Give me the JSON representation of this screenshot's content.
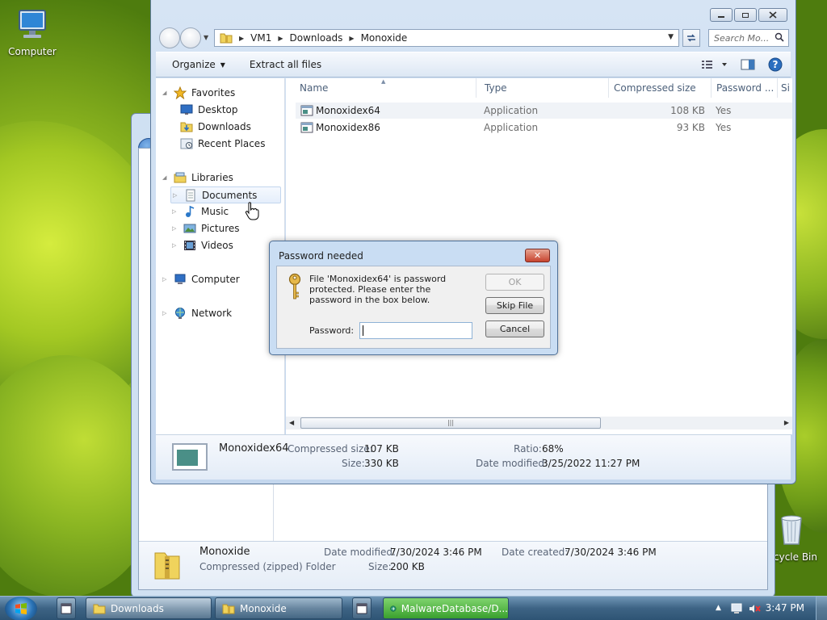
{
  "desktop": {
    "computer_label": "Computer",
    "recycle_label": "cycle Bin"
  },
  "back_window": {
    "folder_name": "Monoxide",
    "folder_type": "Compressed (zipped) Folder",
    "date_modified_label": "Date modified:",
    "date_modified": "7/30/2024 3:46 PM",
    "date_created_label": "Date created:",
    "date_created": "7/30/2024 3:46 PM",
    "size_label": "Size:",
    "size": "200 KB"
  },
  "window": {
    "breadcrumbs": [
      "VM1",
      "Downloads",
      "Monoxide"
    ],
    "search_placeholder": "Search Mo...",
    "toolbar": {
      "organize": "Organize",
      "extract_all": "Extract all files"
    },
    "nav": {
      "favorites": "Favorites",
      "desktop": "Desktop",
      "downloads": "Downloads",
      "recent_places": "Recent Places",
      "libraries": "Libraries",
      "documents": "Documents",
      "music": "Music",
      "pictures": "Pictures",
      "videos": "Videos",
      "computer": "Computer",
      "network": "Network"
    },
    "columns": {
      "name": "Name",
      "type": "Type",
      "compressed_size": "Compressed size",
      "password": "Password ...",
      "size_partial": "Si"
    },
    "files": [
      {
        "name": "Monoxidex64",
        "type": "Application",
        "compressed_size": "108 KB",
        "password": "Yes"
      },
      {
        "name": "Monoxidex86",
        "type": "Application",
        "compressed_size": "93 KB",
        "password": "Yes"
      }
    ],
    "details": {
      "name": "Monoxidex64",
      "compressed_size_label": "Compressed size:",
      "compressed_size": "107 KB",
      "size_label": "Size:",
      "size": "330 KB",
      "ratio_label": "Ratio:",
      "ratio": "68%",
      "date_modified_label": "Date modified:",
      "date_modified": "3/25/2022 11:27 PM"
    }
  },
  "dialog": {
    "title": "Password needed",
    "message": "File 'Monoxidex64' is password protected. Please enter the password in the box below.",
    "password_label": "Password:",
    "password_value": "",
    "ok": "OK",
    "skip": "Skip File",
    "cancel": "Cancel"
  },
  "taskbar": {
    "items": [
      "Downloads",
      "Monoxide",
      "MalwareDatabase/D..."
    ],
    "clock": "3:47 PM"
  }
}
